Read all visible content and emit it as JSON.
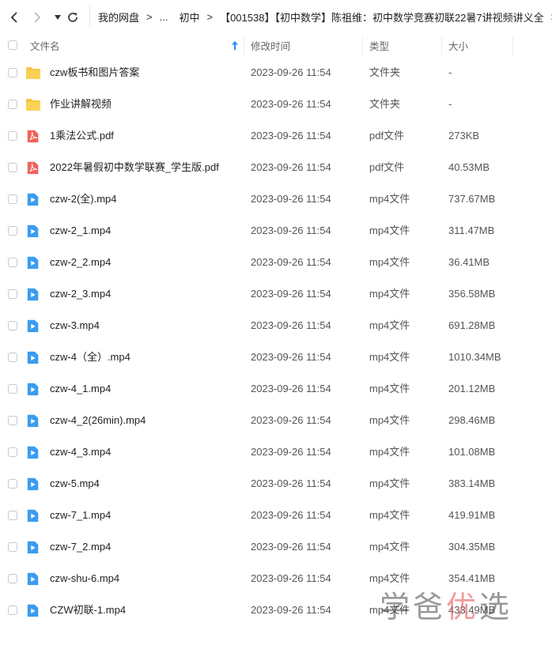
{
  "breadcrumb": {
    "items": [
      "我的网盘",
      "...",
      "初中",
      "【001538】【初中数学】陈祖维：初中数学竞赛初联22暑7讲视频讲义全"
    ]
  },
  "columns": {
    "name": "文件名",
    "modified": "修改时间",
    "type": "类型",
    "size": "大小"
  },
  "files": [
    {
      "icon": "folder-icon",
      "name": "czw板书和图片答案",
      "modified": "2023-09-26 11:54",
      "type": "文件夹",
      "size": "-"
    },
    {
      "icon": "folder-icon",
      "name": "作业讲解视频",
      "modified": "2023-09-26 11:54",
      "type": "文件夹",
      "size": "-"
    },
    {
      "icon": "pdf-icon",
      "name": "1乘法公式.pdf",
      "modified": "2023-09-26 11:54",
      "type": "pdf文件",
      "size": "273KB"
    },
    {
      "icon": "pdf-icon",
      "name": "2022年暑假初中数学联赛_学生版.pdf",
      "modified": "2023-09-26 11:54",
      "type": "pdf文件",
      "size": "40.53MB"
    },
    {
      "icon": "video-icon",
      "name": "czw-2(全).mp4",
      "modified": "2023-09-26 11:54",
      "type": "mp4文件",
      "size": "737.67MB"
    },
    {
      "icon": "video-icon",
      "name": "czw-2_1.mp4",
      "modified": "2023-09-26 11:54",
      "type": "mp4文件",
      "size": "311.47MB"
    },
    {
      "icon": "video-icon",
      "name": "czw-2_2.mp4",
      "modified": "2023-09-26 11:54",
      "type": "mp4文件",
      "size": "36.41MB"
    },
    {
      "icon": "video-icon",
      "name": "czw-2_3.mp4",
      "modified": "2023-09-26 11:54",
      "type": "mp4文件",
      "size": "356.58MB"
    },
    {
      "icon": "video-icon",
      "name": "czw-3.mp4",
      "modified": "2023-09-26 11:54",
      "type": "mp4文件",
      "size": "691.28MB"
    },
    {
      "icon": "video-icon",
      "name": "czw-4（全）.mp4",
      "modified": "2023-09-26 11:54",
      "type": "mp4文件",
      "size": "1010.34MB"
    },
    {
      "icon": "video-icon",
      "name": "czw-4_1.mp4",
      "modified": "2023-09-26 11:54",
      "type": "mp4文件",
      "size": "201.12MB"
    },
    {
      "icon": "video-icon",
      "name": "czw-4_2(26min).mp4",
      "modified": "2023-09-26 11:54",
      "type": "mp4文件",
      "size": "298.46MB"
    },
    {
      "icon": "video-icon",
      "name": "czw-4_3.mp4",
      "modified": "2023-09-26 11:54",
      "type": "mp4文件",
      "size": "101.08MB"
    },
    {
      "icon": "video-icon",
      "name": "czw-5.mp4",
      "modified": "2023-09-26 11:54",
      "type": "mp4文件",
      "size": "383.14MB"
    },
    {
      "icon": "video-icon",
      "name": "czw-7_1.mp4",
      "modified": "2023-09-26 11:54",
      "type": "mp4文件",
      "size": "419.91MB"
    },
    {
      "icon": "video-icon",
      "name": "czw-7_2.mp4",
      "modified": "2023-09-26 11:54",
      "type": "mp4文件",
      "size": "304.35MB"
    },
    {
      "icon": "video-icon",
      "name": "czw-shu-6.mp4",
      "modified": "2023-09-26 11:54",
      "type": "mp4文件",
      "size": "354.41MB"
    },
    {
      "icon": "video-icon",
      "name": "CZW初联-1.mp4",
      "modified": "2023-09-26 11:54",
      "type": "mp4文件",
      "size": "433.49MB"
    }
  ],
  "watermark": {
    "a": "学爸",
    "b": "优",
    "c": "选"
  },
  "colors": {
    "folder": "#f7c544",
    "pdf": "#f0625c",
    "video": "#3a9cf0",
    "sort_arrow": "#1e90ff"
  }
}
